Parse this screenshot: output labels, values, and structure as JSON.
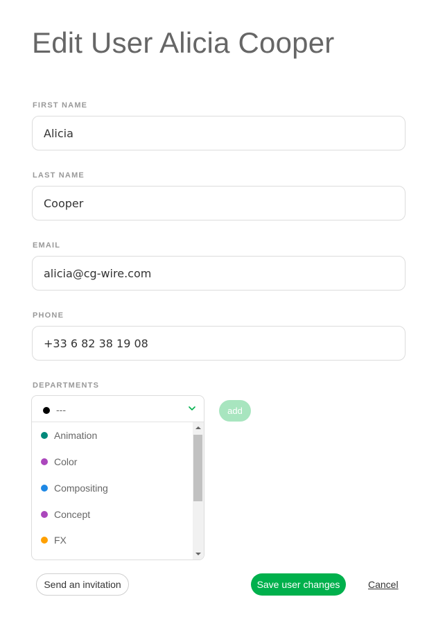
{
  "page": {
    "title": "Edit User Alicia Cooper"
  },
  "form": {
    "first_name": {
      "label": "First name",
      "value": "Alicia"
    },
    "last_name": {
      "label": "Last name",
      "value": "Cooper"
    },
    "email": {
      "label": "Email",
      "value": "alicia@cg-wire.com"
    },
    "phone": {
      "label": "Phone",
      "value": "+33 6 82 38 19 08"
    }
  },
  "departments": {
    "label": "Departments",
    "selected": {
      "label": "---",
      "color": "#000000"
    },
    "options": [
      {
        "label": "Animation",
        "color": "#00897b"
      },
      {
        "label": "Color",
        "color": "#ab47bc"
      },
      {
        "label": "Compositing",
        "color": "#1e88e5"
      },
      {
        "label": "Concept",
        "color": "#ab47bc"
      },
      {
        "label": "FX",
        "color": "#ffa000"
      }
    ],
    "add_label": "add",
    "chevron_icon": "chevron-down-icon",
    "accent_color": "#00b04c"
  },
  "actions": {
    "invite_label": "Send an invitation",
    "save_label": "Save user changes",
    "cancel_label": "Cancel"
  }
}
